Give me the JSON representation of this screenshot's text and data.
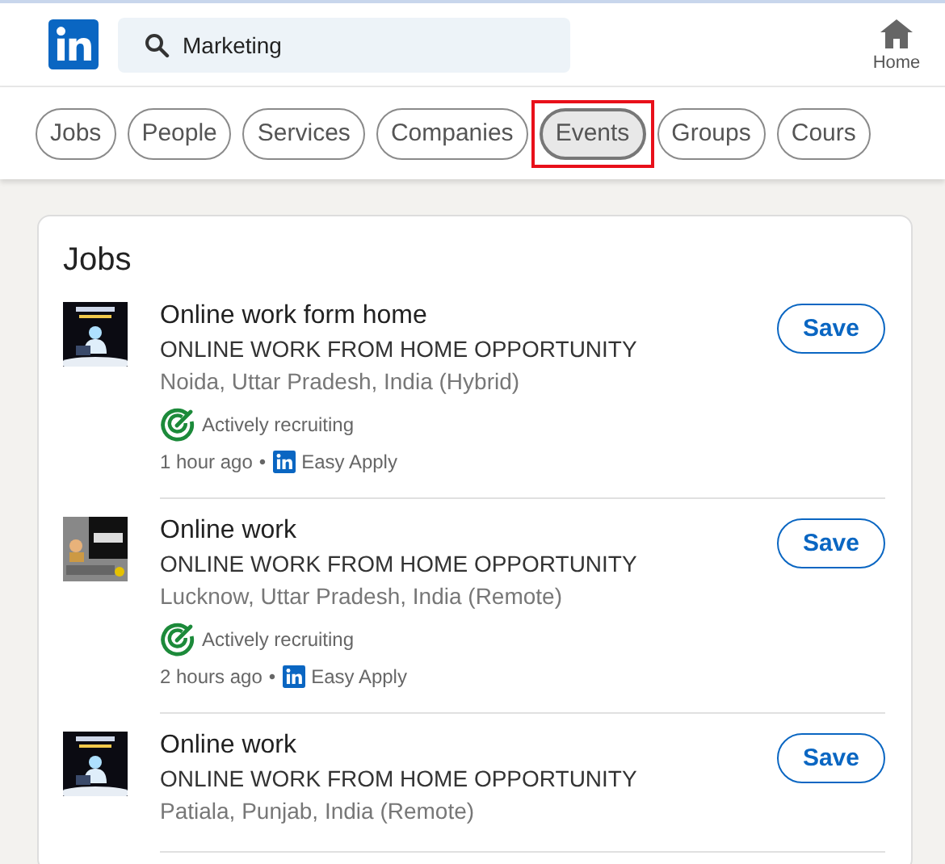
{
  "search": {
    "value": "Marketing"
  },
  "nav": {
    "home_label": "Home"
  },
  "filters": [
    {
      "label": "Jobs",
      "selected": false,
      "highlighted": false
    },
    {
      "label": "People",
      "selected": false,
      "highlighted": false
    },
    {
      "label": "Services",
      "selected": false,
      "highlighted": false
    },
    {
      "label": "Companies",
      "selected": false,
      "highlighted": false
    },
    {
      "label": "Events",
      "selected": true,
      "highlighted": true
    },
    {
      "label": "Groups",
      "selected": false,
      "highlighted": false
    },
    {
      "label": "Cours",
      "selected": false,
      "highlighted": false
    }
  ],
  "jobs_section": {
    "title": "Jobs",
    "jobs": [
      {
        "title": "Online work form home",
        "company": "ONLINE WORK FROM HOME OPPORTUNITY",
        "location": "Noida, Uttar Pradesh, India (Hybrid)",
        "recruiting": "Actively recruiting",
        "posted": "1 hour ago",
        "separator": "•",
        "apply": "Easy Apply",
        "save": "Save"
      },
      {
        "title": "Online work",
        "company": "ONLINE WORK FROM HOME OPPORTUNITY",
        "location": "Lucknow, Uttar Pradesh, India (Remote)",
        "recruiting": "Actively recruiting",
        "posted": "2 hours ago",
        "separator": "•",
        "apply": "Easy Apply",
        "save": "Save"
      },
      {
        "title": "Online work",
        "company": "ONLINE WORK FROM HOME OPPORTUNITY",
        "location": "Patiala, Punjab, India (Remote)",
        "save": "Save"
      }
    ]
  }
}
